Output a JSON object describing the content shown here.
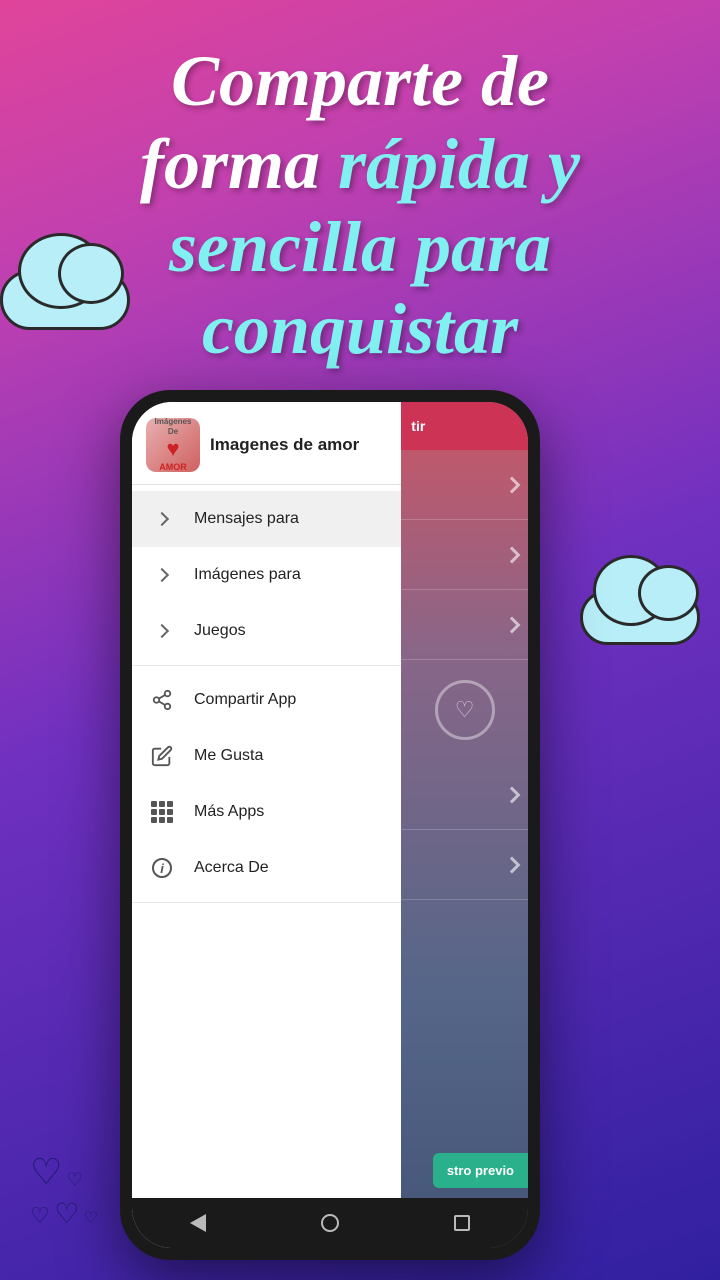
{
  "hero": {
    "line1": "Comparte de",
    "line2": "forma rápida y",
    "line3": "sencilla para",
    "line4": "conquistar"
  },
  "app": {
    "name": "Imagenes de amor",
    "icon_label_top": "Imágenes",
    "icon_label_mid": "De",
    "icon_label_bottom": "AMOR"
  },
  "menu": {
    "sections": [
      {
        "items": [
          {
            "id": "mensajes",
            "label": "Mensajes para",
            "type": "chevron",
            "active": true
          },
          {
            "id": "imagenes",
            "label": "Imágenes para",
            "type": "chevron",
            "active": false
          },
          {
            "id": "juegos",
            "label": "Juegos",
            "type": "chevron",
            "active": false
          }
        ]
      },
      {
        "items": [
          {
            "id": "compartir",
            "label": "Compartir App",
            "type": "share",
            "active": false
          },
          {
            "id": "megusta",
            "label": "Me Gusta",
            "type": "rating",
            "active": false
          },
          {
            "id": "masapps",
            "label": "Más Apps",
            "type": "grid",
            "active": false
          },
          {
            "id": "acercade",
            "label": "Acerca De",
            "type": "info",
            "active": false
          }
        ]
      }
    ]
  },
  "bottom": {
    "teal_button": "stro previo"
  }
}
